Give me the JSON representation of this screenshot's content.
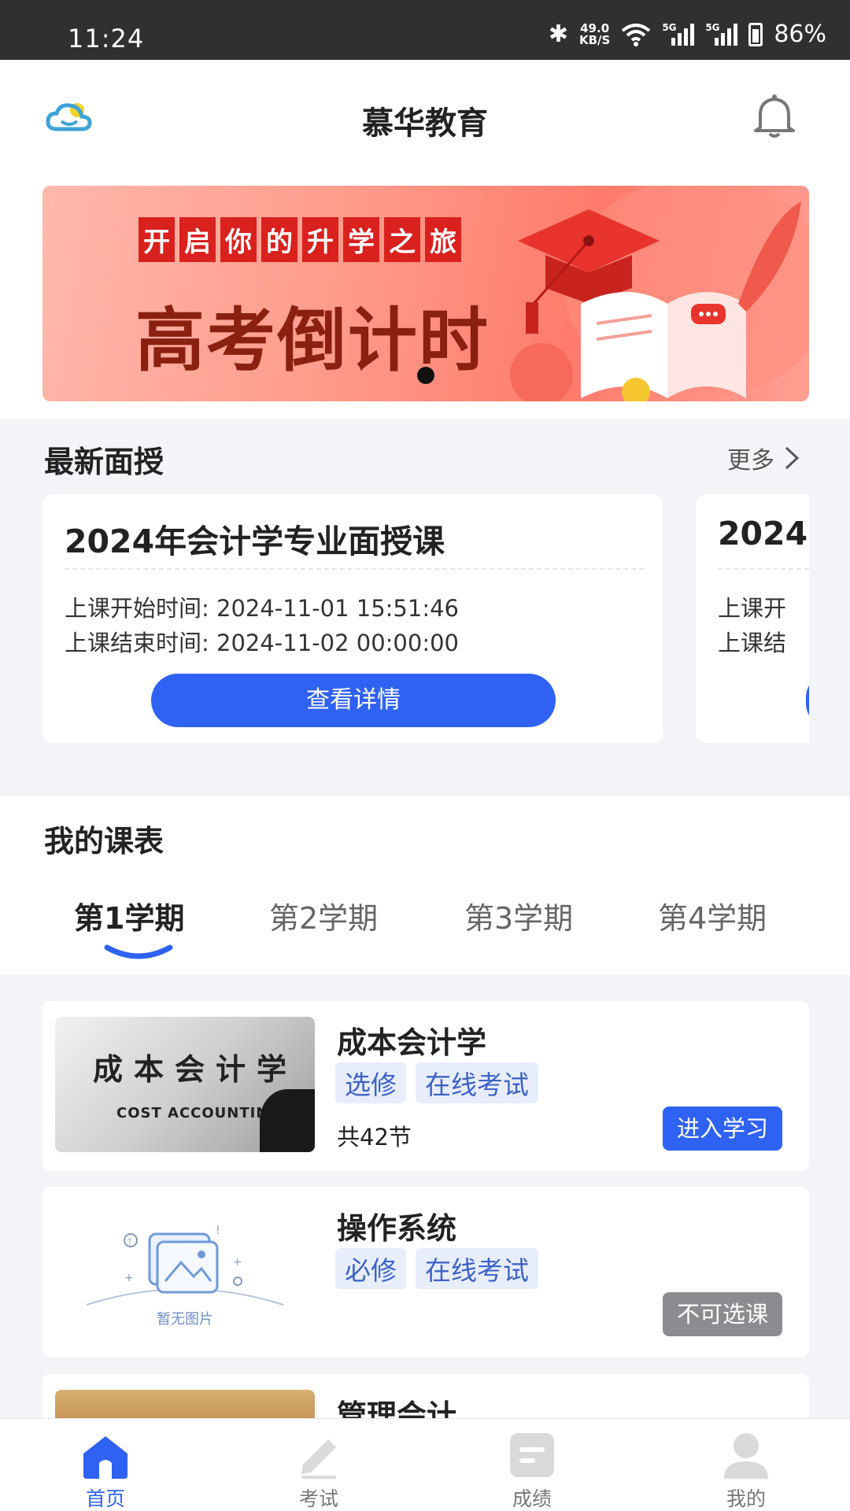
{
  "status_bar": {
    "time": "11:24",
    "net_speed": "49.0",
    "net_unit": "KB/S",
    "sim1": "5G",
    "sim2": "5G",
    "battery": "86%"
  },
  "header": {
    "title": "慕华教育",
    "logo_icon": "cloud-logo-icon",
    "bell_icon": "bell-icon"
  },
  "banner": {
    "tagline_chars": [
      "开",
      "启",
      "你",
      "的",
      "升",
      "学",
      "之",
      "旅"
    ],
    "headline": "高考倒计时"
  },
  "latest": {
    "title": "最新面授",
    "more": "更多",
    "cards": [
      {
        "title": "2024年会计学专业面授课",
        "start_label": "上课开始时间:",
        "start_value": "2024-11-01 15:51:46",
        "end_label": "上课结束时间:",
        "end_value": "2024-11-02 00:00:00",
        "button": "查看详情"
      },
      {
        "title": "2024",
        "start_label": "上课开",
        "end_label": "上课结"
      }
    ]
  },
  "schedule": {
    "title": "我的课表",
    "tabs": [
      "第1学期",
      "第2学期",
      "第3学期",
      "第4学期"
    ],
    "active_tab": 0,
    "courses": [
      {
        "name": "成本会计学",
        "tags": [
          "选修",
          "在线考试"
        ],
        "count": "共42节",
        "button": "进入学习",
        "thumb_cn": "成本会计学",
        "thumb_en": "COST ACCOUNTING"
      },
      {
        "name": "操作系统",
        "tags": [
          "必修",
          "在线考试"
        ],
        "button": "不可选课",
        "thumb_placeholder": "暂无图片"
      },
      {
        "name": "管理会计"
      }
    ]
  },
  "bottom_nav": {
    "items": [
      {
        "label": "首页",
        "icon": "home-icon"
      },
      {
        "label": "考试",
        "icon": "exam-icon"
      },
      {
        "label": "成绩",
        "icon": "grades-icon"
      },
      {
        "label": "我的",
        "icon": "profile-icon"
      }
    ],
    "active": 0
  },
  "colors": {
    "primary": "#2f62f2",
    "disabled": "#8b8c8f",
    "tag_bg": "#e8edfb",
    "tag_text": "#3e63c6"
  }
}
